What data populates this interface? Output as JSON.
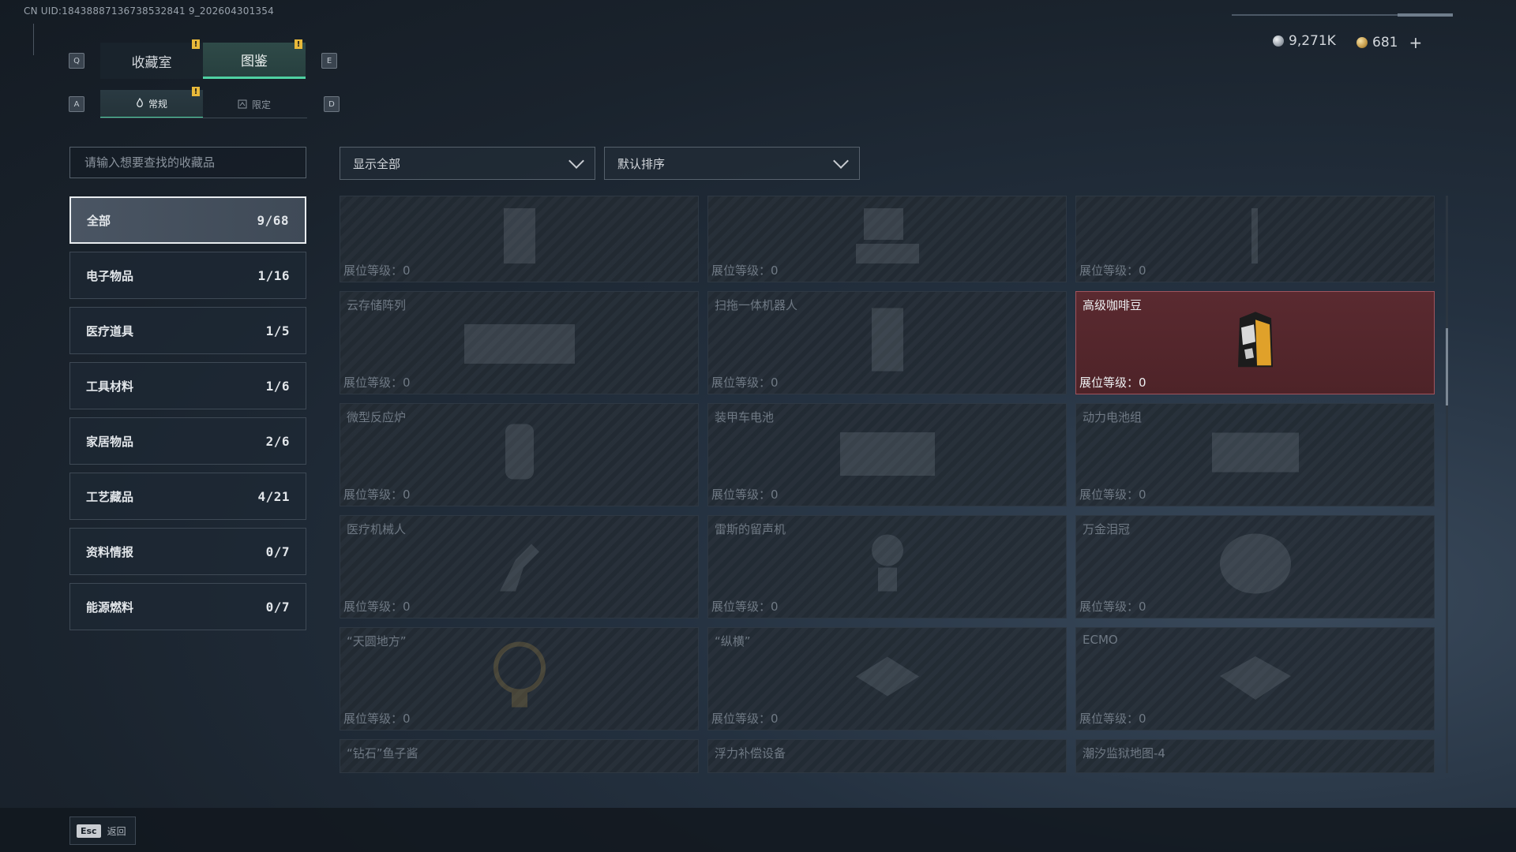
{
  "uid_text": "CN UID:18438887136738532841 9_202604301354",
  "currency": {
    "silver": "9,271K",
    "gold": "681",
    "plus": "+"
  },
  "keys": {
    "left_tab": "Q",
    "right_tab": "E",
    "left_sub": "A",
    "right_sub": "D"
  },
  "tabs": [
    {
      "label": "收藏室"
    },
    {
      "label": "图鉴"
    }
  ],
  "badge_mark": "!",
  "subtabs": [
    {
      "label": "常规"
    },
    {
      "label": "限定"
    }
  ],
  "search": {
    "placeholder": "请输入想要查找的收藏品"
  },
  "categories": [
    {
      "label": "全部",
      "count": "9/68"
    },
    {
      "label": "电子物品",
      "count": "1/16"
    },
    {
      "label": "医疗道具",
      "count": "1/5"
    },
    {
      "label": "工具材料",
      "count": "1/6"
    },
    {
      "label": "家居物品",
      "count": "2/6"
    },
    {
      "label": "工艺藏品",
      "count": "4/21"
    },
    {
      "label": "资料情报",
      "count": "0/7"
    },
    {
      "label": "能源燃料",
      "count": "0/7"
    }
  ],
  "filters": {
    "show": "显示全部",
    "sort": "默认排序"
  },
  "level_prefix": "展位等级：",
  "items": [
    {
      "name": "",
      "level": "0"
    },
    {
      "name": "",
      "level": "0"
    },
    {
      "name": "",
      "level": "0"
    },
    {
      "name": "云存储阵列",
      "level": "0"
    },
    {
      "name": "扫拖一体机器人",
      "level": "0"
    },
    {
      "name": "高级咖啡豆",
      "level": "0"
    },
    {
      "name": "微型反应炉",
      "level": "0"
    },
    {
      "name": "装甲车电池",
      "level": "0"
    },
    {
      "name": "动力电池组",
      "level": "0"
    },
    {
      "name": "医疗机械人",
      "level": "0"
    },
    {
      "name": "雷斯的留声机",
      "level": "0"
    },
    {
      "name": "万金泪冠",
      "level": "0"
    },
    {
      "name": "“天圆地方”",
      "level": "0"
    },
    {
      "name": "“纵横”",
      "level": "0"
    },
    {
      "name": "ECMO",
      "level": "0"
    },
    {
      "name": "“钻石”鱼子酱",
      "level": ""
    },
    {
      "name": "浮力补偿设备",
      "level": ""
    },
    {
      "name": "潮汐监狱地图-4",
      "level": ""
    }
  ],
  "footer": {
    "esc_key": "Esc",
    "back_label": "返回"
  },
  "colors": {
    "accent": "#4fd1a2",
    "highlight": "#5a2a30",
    "badge": "#e8b93a"
  }
}
